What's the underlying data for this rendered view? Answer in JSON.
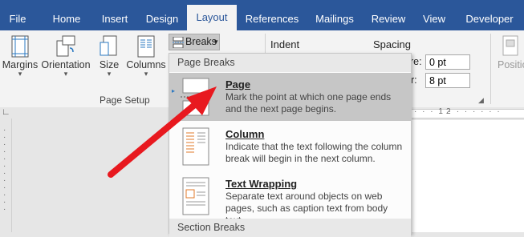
{
  "tabs": [
    {
      "label": "File",
      "active": false
    },
    {
      "label": "Home",
      "active": false
    },
    {
      "label": "Insert",
      "active": false
    },
    {
      "label": "Design",
      "active": false
    },
    {
      "label": "Layout",
      "active": true
    },
    {
      "label": "References",
      "active": false
    },
    {
      "label": "Mailings",
      "active": false
    },
    {
      "label": "Review",
      "active": false
    },
    {
      "label": "View",
      "active": false
    },
    {
      "label": "Developer",
      "active": false
    }
  ],
  "ribbon": {
    "margins_label": "Margins",
    "orientation_label": "Orientation",
    "size_label": "Size",
    "columns_label": "Columns",
    "breaks_label": "Breaks",
    "page_setup_group": "Page Setup",
    "indent_label": "Indent",
    "spacing_label": "Spacing",
    "before_label": "re:",
    "before_value": "0 pt",
    "after_label": "r:",
    "after_value": "8 pt",
    "position_label": "Positio"
  },
  "ruler_mark": "2",
  "menu": {
    "page_breaks_header": "Page Breaks",
    "section_breaks_header": "Section Breaks",
    "items": [
      {
        "title": "Page",
        "desc": "Mark the point at which one page ends and the next page begins."
      },
      {
        "title": "Column",
        "desc": "Indicate that the text following the column break will begin in the next column."
      },
      {
        "title": "Text Wrapping",
        "desc": "Separate text around objects on web pages, such as caption text from body text."
      }
    ]
  },
  "colors": {
    "ribbon_blue": "#2b579a",
    "arrow_red": "#e8191f",
    "highlight": "#c6c6c6"
  }
}
